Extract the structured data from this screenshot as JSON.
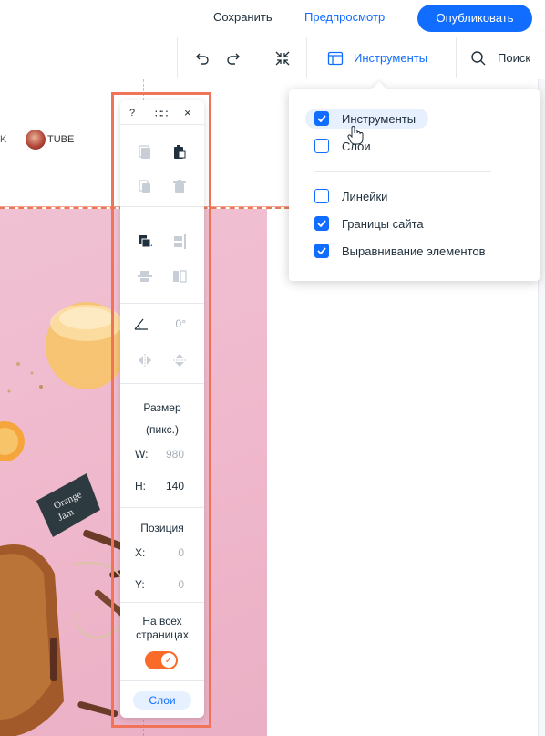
{
  "topbar": {
    "save_label": "Сохранить",
    "preview_label": "Предпросмотр",
    "publish_label": "Опубликовать"
  },
  "toolbar": {
    "undo_icon": "undo-icon",
    "redo_icon": "redo-icon",
    "zoom_icon": "zoom-out-icon",
    "tools_label": "Инструменты",
    "search_label": "Поиск"
  },
  "canvas": {
    "header_partial_letter": "K",
    "youtube_partial_text": "TUBE"
  },
  "panel": {
    "help_label": "?",
    "drag_label": "∷∷",
    "close_label": "×",
    "rotation_value": "0°",
    "size_title": "Размер",
    "size_unit": "(пикс.)",
    "width_key": "W:",
    "width_value": "980",
    "height_key": "H:",
    "height_value": "140",
    "position_title": "Позиция",
    "x_key": "X:",
    "x_value": "0",
    "y_key": "Y:",
    "y_value": "0",
    "all_pages_label": "На всех страницах",
    "all_pages_on": true,
    "layers_button": "Слои"
  },
  "dropdown": {
    "items": [
      {
        "label": "Инструменты",
        "checked": true
      },
      {
        "label": "Слои",
        "checked": false
      },
      {
        "label": "Линейки",
        "checked": false
      },
      {
        "label": "Границы сайта",
        "checked": true
      },
      {
        "label": "Выравнивание элементов",
        "checked": true
      }
    ]
  },
  "colors": {
    "accent": "#116dff",
    "highlight": "#f0735a",
    "toggle": "#fa6a28"
  }
}
